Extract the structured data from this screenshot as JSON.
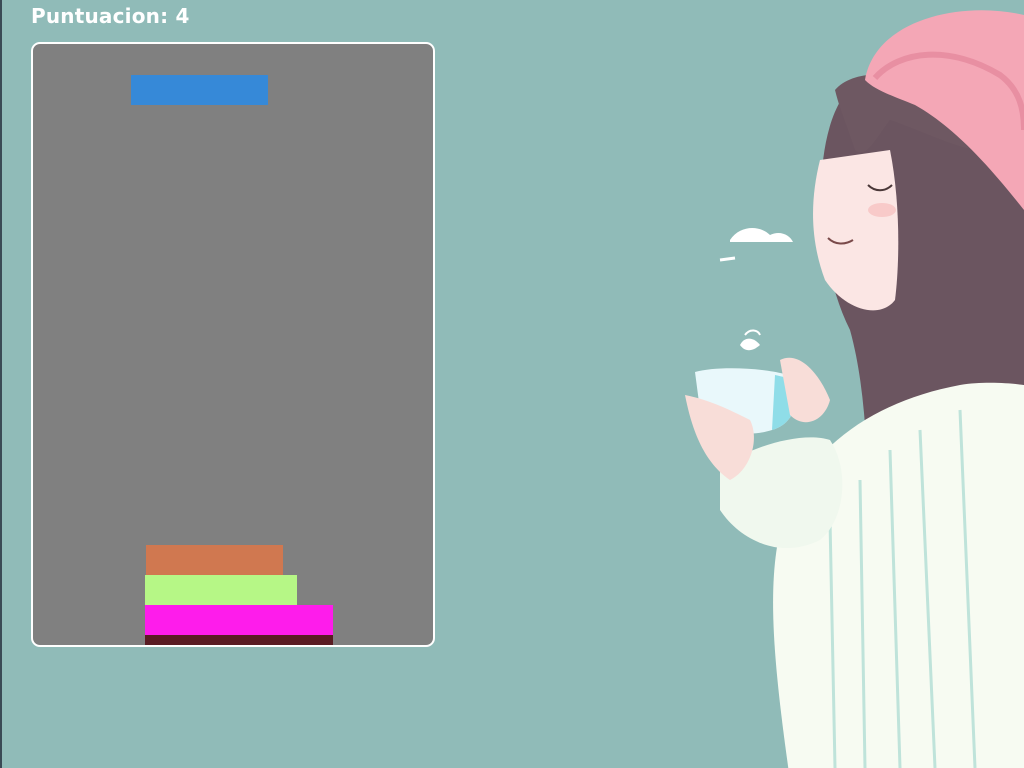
{
  "hud": {
    "score_label": "Puntuacion: 4"
  },
  "game": {
    "falling_block": {
      "color": "#3689d8"
    },
    "stack": [
      {
        "color": "#d07850"
      },
      {
        "color": "#b6f786"
      },
      {
        "color": "#fe1ceb"
      },
      {
        "color": "#5a1c24"
      }
    ]
  },
  "colors": {
    "background": "#90bbb8",
    "board": "#808080",
    "border": "#ffffff"
  },
  "illustration": {
    "subject": "girl-with-beanie-holding-cup"
  }
}
